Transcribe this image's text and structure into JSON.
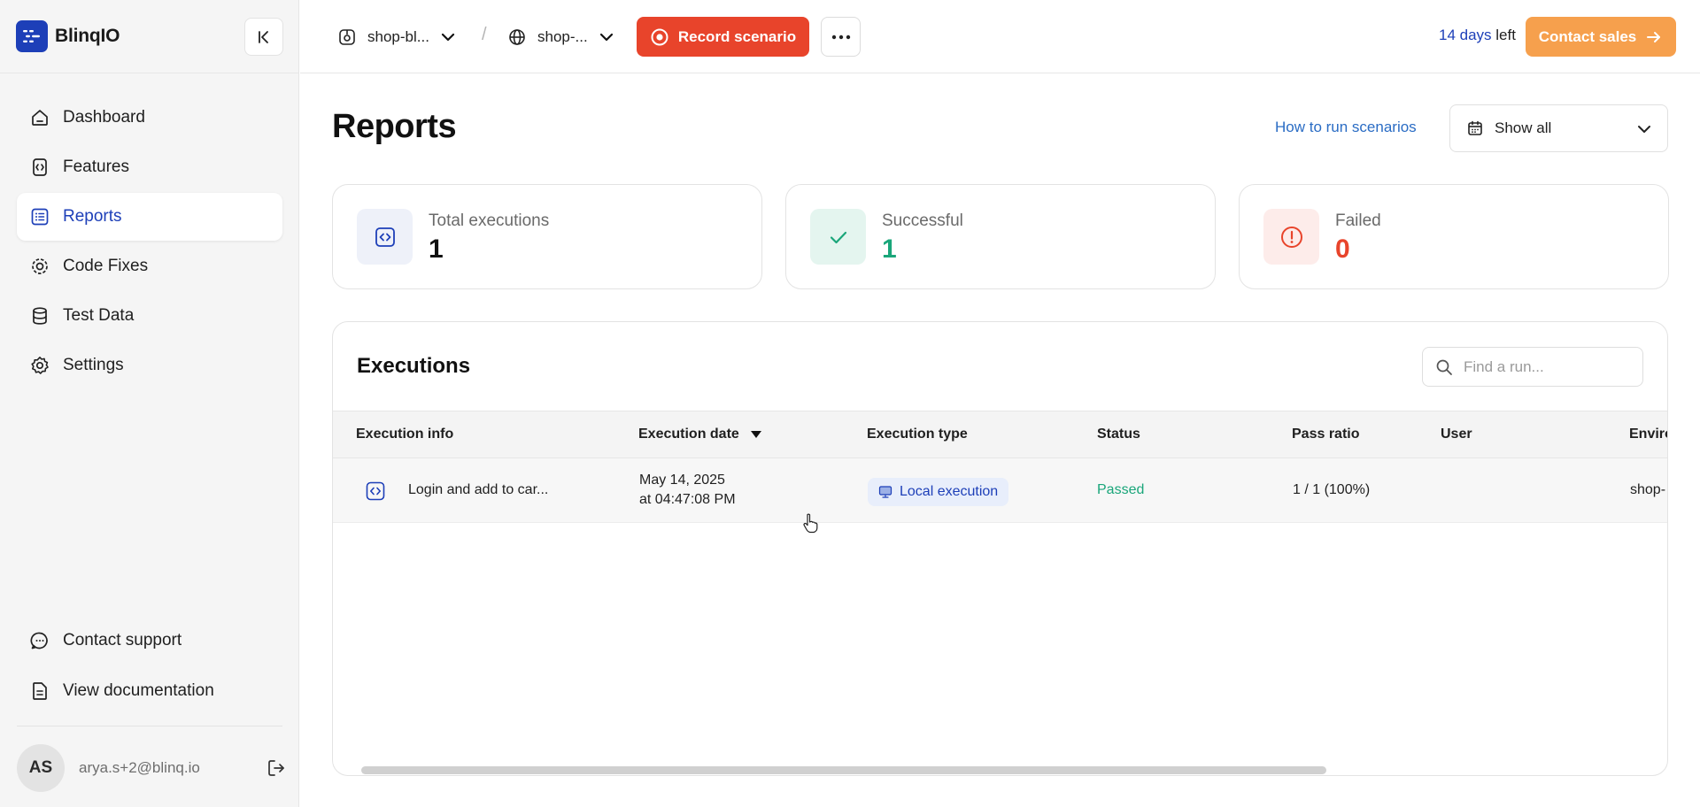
{
  "app": {
    "name": "BlinqIO"
  },
  "sidebar": {
    "items": [
      {
        "label": "Dashboard",
        "icon": "home-icon",
        "active": false
      },
      {
        "label": "Features",
        "icon": "features-icon",
        "active": false
      },
      {
        "label": "Reports",
        "icon": "reports-icon",
        "active": true
      },
      {
        "label": "Code Fixes",
        "icon": "code-fixes-icon",
        "active": false
      },
      {
        "label": "Test Data",
        "icon": "database-icon",
        "active": false
      },
      {
        "label": "Settings",
        "icon": "gear-icon",
        "active": false
      }
    ],
    "bottom": [
      {
        "label": "Contact support",
        "icon": "chat-icon"
      },
      {
        "label": "View documentation",
        "icon": "document-icon"
      }
    ],
    "user": {
      "initials": "AS",
      "email": "arya.s+2@blinq.io"
    }
  },
  "topbar": {
    "project": "shop-bl...",
    "environment": "shop-...",
    "separator": "/",
    "record_label": "Record scenario",
    "trial_days": "14 days",
    "trial_suffix": " left",
    "contact_label": "Contact sales"
  },
  "page": {
    "title": "Reports",
    "help_link": "How to run scenarios",
    "date_filter": "Show all"
  },
  "stats": {
    "total": {
      "label": "Total executions",
      "value": "1"
    },
    "successful": {
      "label": "Successful",
      "value": "1"
    },
    "failed": {
      "label": "Failed",
      "value": "0"
    }
  },
  "executions": {
    "title": "Executions",
    "search_placeholder": "Find a run...",
    "columns": [
      "Execution info",
      "Execution date",
      "Execution type",
      "Status",
      "Pass ratio",
      "User",
      "Enviro"
    ],
    "rows": [
      {
        "info": "Login and add to car...",
        "date_line1": "May 14, 2025",
        "date_line2": "at 04:47:08 PM",
        "type": "Local execution",
        "status": "Passed",
        "pass_ratio": "1 / 1 (100%)",
        "user": "",
        "environment": "shop-"
      }
    ]
  },
  "colors": {
    "brand": "#1d3fb8",
    "record": "#e8442b",
    "contact": "#f6a04d",
    "success": "#1aa67a",
    "danger": "#e8442b"
  }
}
